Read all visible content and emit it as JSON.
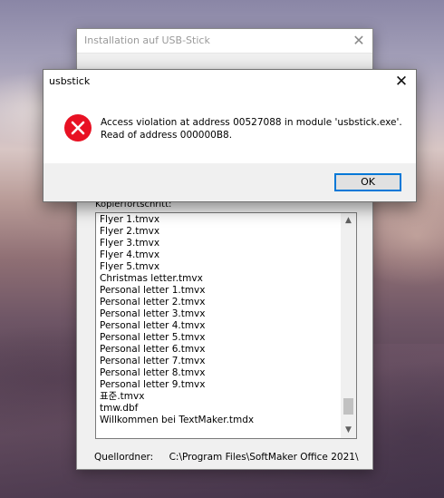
{
  "background_window": {
    "title": "Installation auf USB-Stick",
    "progress_label": "Kopierfortschritt:",
    "files": [
      "Flyer 1.tmvx",
      "Flyer 2.tmvx",
      "Flyer 3.tmvx",
      "Flyer 4.tmvx",
      "Flyer 5.tmvx",
      "Christmas letter.tmvx",
      "Personal letter 1.tmvx",
      "Personal letter 2.tmvx",
      "Personal letter 3.tmvx",
      "Personal letter 4.tmvx",
      "Personal letter 5.tmvx",
      "Personal letter 6.tmvx",
      "Personal letter 7.tmvx",
      "Personal letter 8.tmvx",
      "Personal letter 9.tmvx",
      "표준.tmvx",
      "tmw.dbf",
      "Willkommen bei TextMaker.tmdx"
    ],
    "source_label": "Quellordner:",
    "source_value": "C:\\Program Files\\SoftMaker Office 2021\\"
  },
  "dialog": {
    "title": "usbstick",
    "message_line1": "Access violation at address 00527088 in module 'usbstick.exe'.",
    "message_line2": "Read of address 000000B8.",
    "ok_label": "OK"
  },
  "colors": {
    "error_red": "#e81123",
    "focus_blue": "#0078d7"
  }
}
